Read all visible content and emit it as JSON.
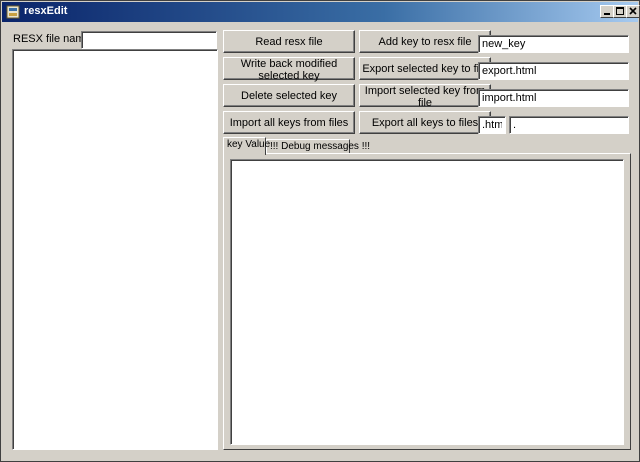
{
  "window": {
    "title": "resxEdit"
  },
  "left_panel": {
    "file_label": "RESX file name",
    "file_value": ""
  },
  "buttons": {
    "read_resx": "Read resx file",
    "write_back": "Write back modified selected key",
    "delete_selected": "Delete selected key",
    "import_all": "Import all keys from files",
    "add_key": "Add key to resx file",
    "export_selected": "Export selected key to file",
    "import_selected": "Import selected key from file",
    "export_all": "Export all keys to files"
  },
  "fields": {
    "new_key": "new_key",
    "export_file": "export.html",
    "import_file": "import.html",
    "extension": ".html",
    "separator": "."
  },
  "tabs": [
    {
      "label": "key Value",
      "active": true
    },
    {
      "label": "!!! Debug messages !!!",
      "active": false
    }
  ]
}
